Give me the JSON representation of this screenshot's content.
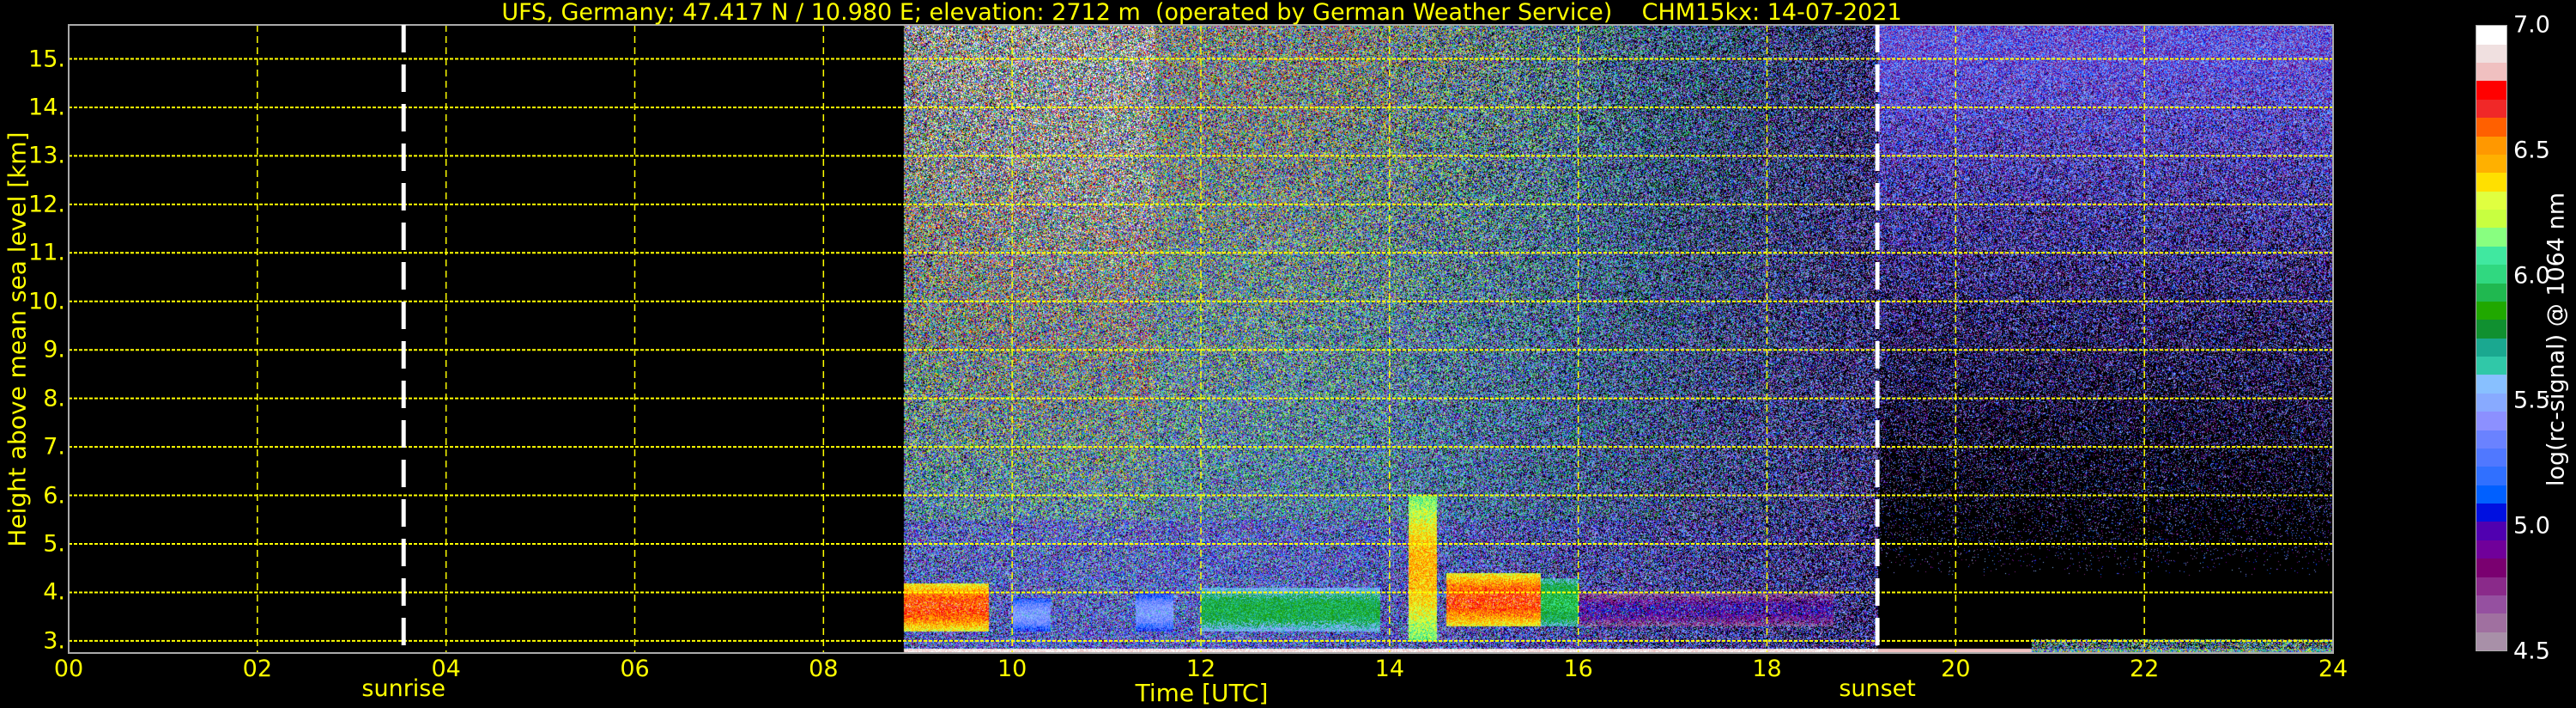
{
  "chart_data": {
    "type": "heatmap",
    "title": "UFS, Germany; 47.417 N / 10.980 E; elevation: 2712 m  (operated by German Weather Service)    CHM15kx: 14-07-2021",
    "xlabel": "Time [UTC]",
    "ylabel": "Height above mean sea level [km]",
    "xlim": [
      0,
      24
    ],
    "ylim": [
      2.75,
      15.7
    ],
    "x_ticks": [
      "00",
      "02",
      "04",
      "06",
      "08",
      "10",
      "12",
      "14",
      "16",
      "18",
      "20",
      "22",
      "24"
    ],
    "x_tick_values": [
      0,
      2,
      4,
      6,
      8,
      10,
      12,
      14,
      16,
      18,
      20,
      22,
      24
    ],
    "y_ticks": [
      "3.",
      "4.",
      "5.",
      "6.",
      "7.",
      "8.",
      "9.",
      "10.",
      "11.",
      "12.",
      "13.",
      "14.",
      "15."
    ],
    "y_tick_values": [
      3,
      4,
      5,
      6,
      7,
      8,
      9,
      10,
      11,
      12,
      13,
      14,
      15
    ],
    "grid": true,
    "data_start_hour": 8.85,
    "sunrise": {
      "label": "sunrise",
      "hour": 3.55
    },
    "sunset": {
      "label": "sunset",
      "hour": 19.17
    },
    "cloud_layers": [
      {
        "start": 8.85,
        "end": 9.75,
        "bottom": 3.2,
        "top": 4.2,
        "level": 6.6
      },
      {
        "start": 10.0,
        "end": 10.4,
        "bottom": 3.2,
        "top": 3.9,
        "level": 5.4
      },
      {
        "start": 11.3,
        "end": 11.7,
        "bottom": 3.2,
        "top": 4.0,
        "level": 5.4
      },
      {
        "start": 12.0,
        "end": 13.9,
        "bottom": 3.2,
        "top": 4.1,
        "level": 5.8
      },
      {
        "start": 14.2,
        "end": 14.5,
        "bottom": 3.0,
        "top": 6.0,
        "level": 6.4
      },
      {
        "start": 14.6,
        "end": 15.6,
        "bottom": 3.3,
        "top": 4.4,
        "level": 6.6
      },
      {
        "start": 15.6,
        "end": 16.0,
        "bottom": 3.3,
        "top": 4.3,
        "level": 5.9
      },
      {
        "start": 16.0,
        "end": 18.7,
        "bottom": 3.3,
        "top": 4.0,
        "level": 4.9
      }
    ],
    "colorbar": {
      "label": "log(rc-signal) @ 1064 nm",
      "range": [
        4.5,
        7.0
      ],
      "ticks": [
        "4.5",
        "5.0",
        "5.5",
        "6.0",
        "6.5",
        "7.0"
      ],
      "tick_values": [
        4.5,
        5.0,
        5.5,
        6.0,
        6.5,
        7.0
      ],
      "colors": [
        "#a890a8",
        "#a070a0",
        "#9550a0",
        "#8a2a8a",
        "#7a0070",
        "#70009a",
        "#5000b0",
        "#0010e0",
        "#0060ff",
        "#3070ff",
        "#5078ff",
        "#6a82ff",
        "#8c90ff",
        "#88aaff",
        "#88c0ff",
        "#30c8a8",
        "#1aa890",
        "#109030",
        "#20a800",
        "#20b850",
        "#30d880",
        "#40e8a0",
        "#88ff80",
        "#c8ff40",
        "#e0ff40",
        "#ffe000",
        "#ffb000",
        "#ff9800",
        "#ff6000",
        "#f02828",
        "#ff0000",
        "#f0c0c0",
        "#f0e0e0",
        "#ffffff"
      ]
    }
  },
  "colors": {
    "text": "#ffff00",
    "grid": "#ffff00",
    "background": "#000000",
    "marker": "#ffffff"
  }
}
